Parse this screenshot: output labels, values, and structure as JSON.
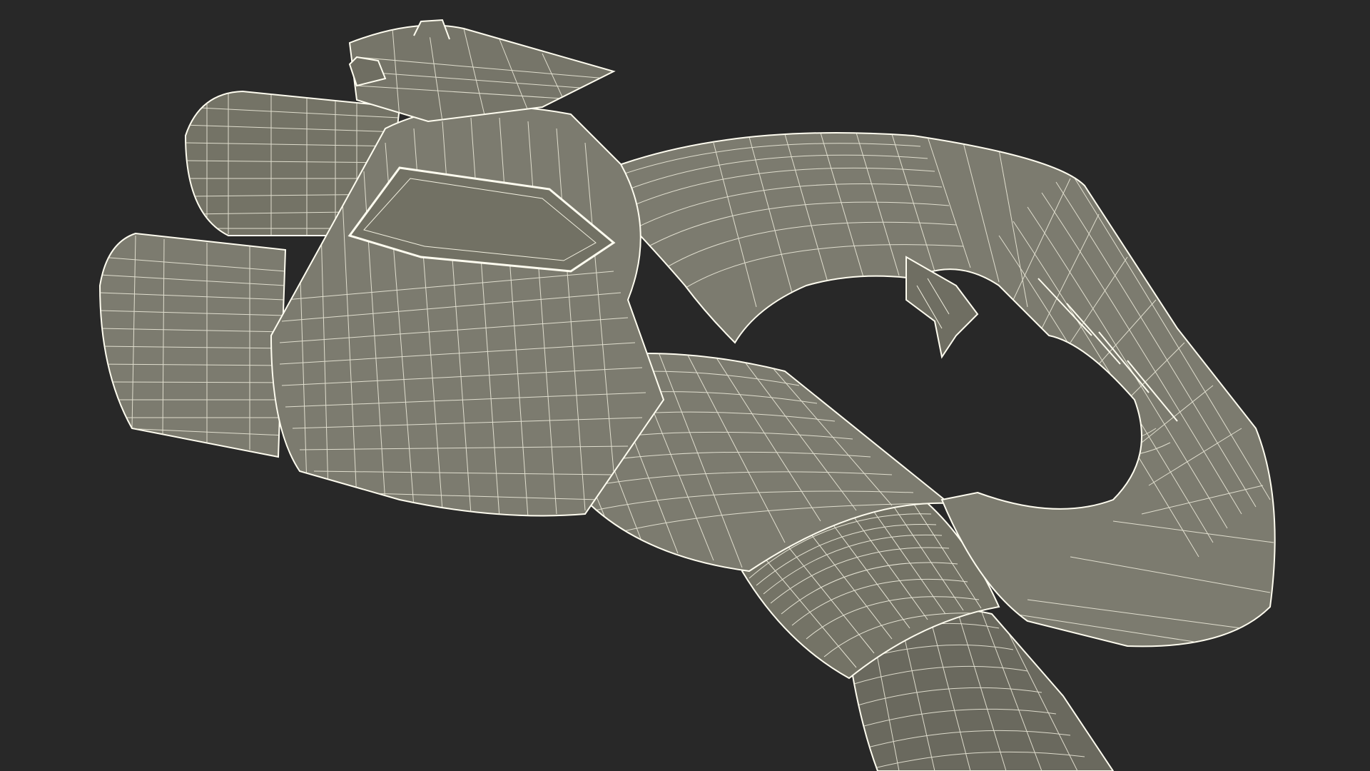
{
  "scene": {
    "subject": "wireframe-render",
    "background_color": "#282828",
    "surface_color": "#7c7b6f",
    "surface_shade_color": "#6a695e",
    "surface_light_color": "#8a897d",
    "wire_color": "#f2f0e0",
    "edge_highlight_color": "#fffdf0"
  }
}
